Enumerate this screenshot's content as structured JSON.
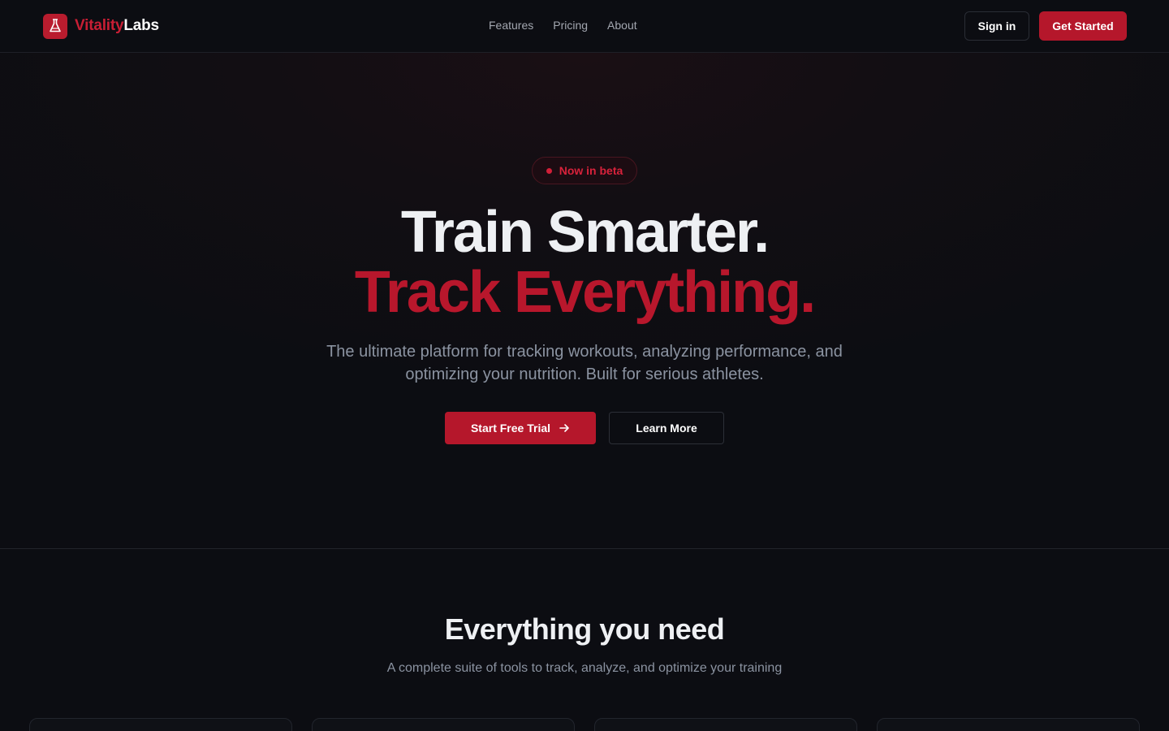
{
  "nav": {
    "brand_a": "Vitality",
    "brand_b": "Labs",
    "links": [
      "Features",
      "Pricing",
      "About"
    ],
    "signin": "Sign in",
    "get_started": "Get Started"
  },
  "hero": {
    "badge": "Now in beta",
    "title_line1": "Train Smarter.",
    "title_line2": "Track Everything.",
    "lead": "The ultimate platform for tracking workouts, analyzing performance, and optimizing your nutrition. Built for serious athletes.",
    "cta_primary": "Start Free Trial",
    "cta_secondary": "Learn More"
  },
  "features": {
    "title": "Everything you need",
    "subtitle": "A complete suite of tools to track, analyze, and optimize your training"
  },
  "colors": {
    "accent": "#b5172b",
    "background": "#0c0d12",
    "muted_text": "#8b93a1"
  },
  "icons": {
    "logo": "flask-icon",
    "cta_arrow": "arrow-right-icon"
  }
}
